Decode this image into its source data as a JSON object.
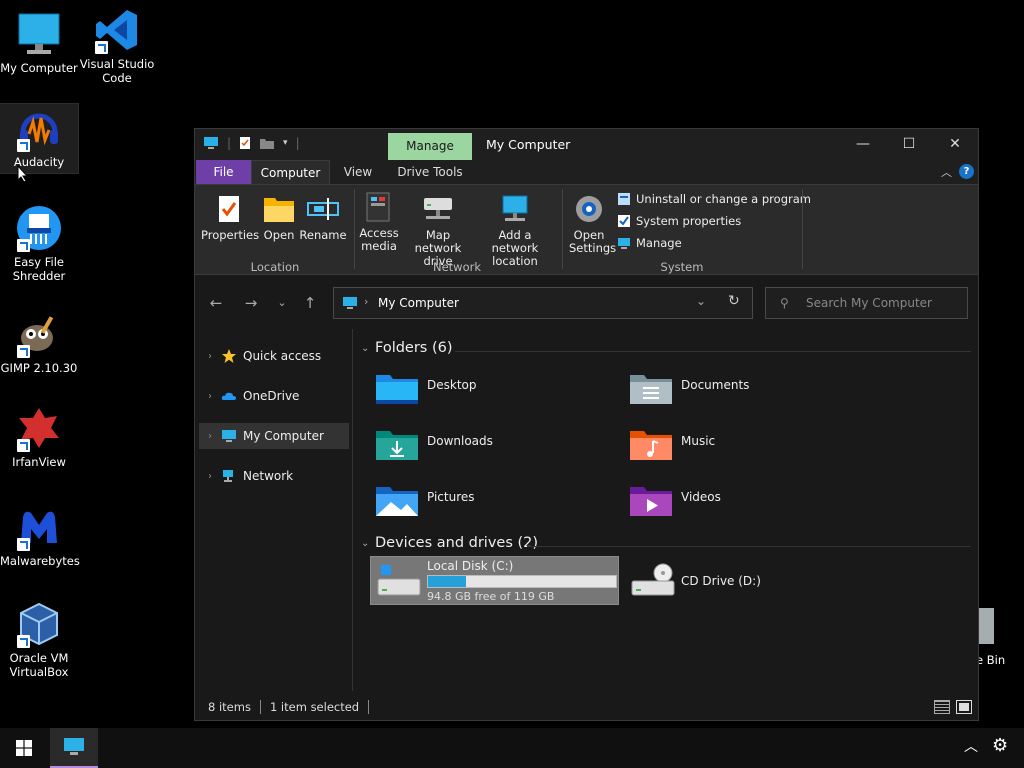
{
  "desktop": {
    "icons": [
      {
        "label": "My Computer"
      },
      {
        "label": "Visual Studio Code"
      },
      {
        "label": "Audacity"
      },
      {
        "label": "Easy File Shredder"
      },
      {
        "label": "GIMP 2.10.30"
      },
      {
        "label": "IrfanView"
      },
      {
        "label": "Malwarebytes"
      },
      {
        "label": "Oracle VM VirtualBox"
      },
      {
        "label": "e Bin"
      }
    ]
  },
  "window": {
    "title": "My Computer",
    "context_tab": "Manage",
    "tabs": {
      "file": "File",
      "computer": "Computer",
      "view": "View",
      "drive_tools": "Drive Tools"
    },
    "ribbon": {
      "location": {
        "properties": "Properties",
        "open": "Open",
        "rename": "Rename",
        "label": "Location"
      },
      "network": {
        "access_media": "Access media",
        "map_drive": "Map network drive",
        "add_location": "Add a network location",
        "label": "Network"
      },
      "system": {
        "open_settings": "Open Settings",
        "uninstall": "Uninstall or change a program",
        "sys_props": "System properties",
        "manage": "Manage",
        "label": "System"
      }
    },
    "address": {
      "path": "My Computer",
      "search_placeholder": "Search My Computer"
    },
    "nav": {
      "quick_access": "Quick access",
      "onedrive": "OneDrive",
      "my_computer": "My Computer",
      "network": "Network"
    },
    "folders": {
      "heading": "Folders (6)",
      "items": [
        "Desktop",
        "Documents",
        "Downloads",
        "Music",
        "Pictures",
        "Videos"
      ]
    },
    "drives": {
      "heading": "Devices and drives (2)",
      "c": {
        "name": "Local Disk (C:)",
        "free": "94.8 GB free of 119 GB",
        "used_fraction": 0.2
      },
      "d": {
        "name": "CD Drive (D:)"
      }
    },
    "status": {
      "items": "8 items",
      "selected": "1 item selected"
    }
  },
  "colors": {
    "file_tab": "#6d3fa7",
    "manage_tab": "#9bd6a0",
    "drive_fill": "#26a0da"
  }
}
